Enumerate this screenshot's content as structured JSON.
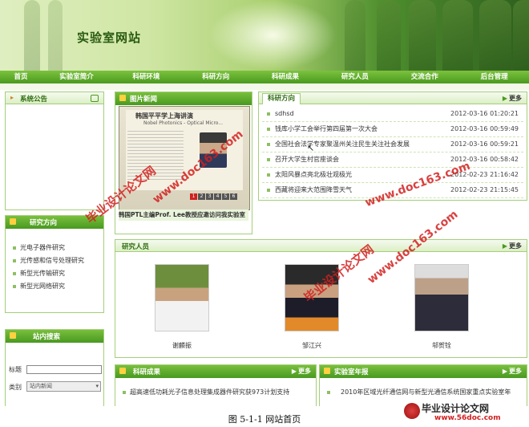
{
  "site": {
    "title": "实验室网站"
  },
  "nav": [
    "首页",
    "实验室简介",
    "科研环境",
    "科研方向",
    "科研成果",
    "研究人员",
    "交流合作",
    "后台管理"
  ],
  "announce": {
    "title": "系统公告"
  },
  "photo_news": {
    "title": "图片新闻",
    "paper_head": "韩国平平学上海讲演",
    "paper_sub": "Nobel Photonics - Optical Micro...",
    "pager": [
      "1",
      "2",
      "3",
      "4",
      "5",
      "6"
    ],
    "caption": "韩国PTL主编Prof. Lee教授应邀访问我实验室"
  },
  "research_news": {
    "title": "科研方向",
    "more": "更多",
    "items": [
      {
        "text": "sdhsd",
        "date": "2012-03-16 01:20:21"
      },
      {
        "text": "钱库小学工会举行第四届第一次大会",
        "date": "2012-03-16 00:59:49"
      },
      {
        "text": "全国社会法学专家聚温州关注民生关注社会发展",
        "date": "2012-03-16 00:59:21"
      },
      {
        "text": "召开大学生村官座谈会",
        "date": "2012-03-16 00:58:42"
      },
      {
        "text": "太阳风暴点亮北极壮观极光",
        "date": "2012-02-23 21:16:42"
      },
      {
        "text": "西藏将迎来大范围降雪天气",
        "date": "2012-02-23 21:15:45"
      }
    ]
  },
  "directions": {
    "title": "研究方向",
    "items": [
      "光电子器件研究",
      "光传感和信号处理研究",
      "新型光传输研究",
      "新型光网络研究"
    ]
  },
  "people": {
    "title": "研究人员",
    "more": "更多",
    "items": [
      {
        "name": "谢麟振"
      },
      {
        "name": "邹江兴"
      },
      {
        "name": "邬贺铨"
      }
    ]
  },
  "search": {
    "title": "站内搜索",
    "label_title": "标题",
    "label_type": "类别",
    "type_value": "站内新闻"
  },
  "achievements": {
    "title": "科研成果",
    "more": "更多",
    "items": [
      "超高速低功耗光子信息处理集成器件研究获973计划支持"
    ]
  },
  "annual": {
    "title": "实验室年报",
    "more": "更多",
    "items": [
      "2010年区域光纤通信网与新型光通信系统国家重点实验室年"
    ]
  },
  "watermarks": [
    "毕业设计论文网",
    "www.doc163.com",
    "毕业设计论文网",
    "www.doc163.com",
    "www.doc163.com"
  ],
  "figure_caption": "图 5-1-1 网站首页",
  "brand": {
    "name": "毕业设计论文网",
    "url": "www.56doc.com"
  },
  "colors": {
    "nav": "#4a9a1e",
    "border": "#a4cf7a",
    "watermark": "#d32020"
  }
}
